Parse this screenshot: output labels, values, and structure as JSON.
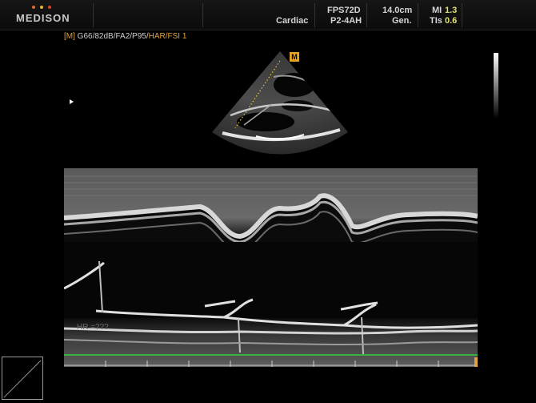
{
  "header": {
    "logo": "MEDISON",
    "logo_dot_colors": [
      "#e06a2a",
      "#e8b430",
      "#d8402a"
    ],
    "application": "Cardiac",
    "preset": "FPS72D",
    "probe": "P2-4AH",
    "depth": "14.0cm",
    "mode": "Gen.",
    "mi_label": "MI",
    "mi_value": "1.3",
    "tis_label": "TIs",
    "tis_value": "0.6"
  },
  "params": {
    "mode_tag": "[M]",
    "values": "G66/82dB/FA2/P95/",
    "harmonic": "HAR/FSI 1"
  },
  "image": {
    "m_badge": "M"
  },
  "mmode": {
    "hr_label": "HR =???"
  },
  "colors": {
    "accent_orange": "#e2a140",
    "ecg_green": "#2fd23a",
    "m_line": "#e8c23a"
  }
}
